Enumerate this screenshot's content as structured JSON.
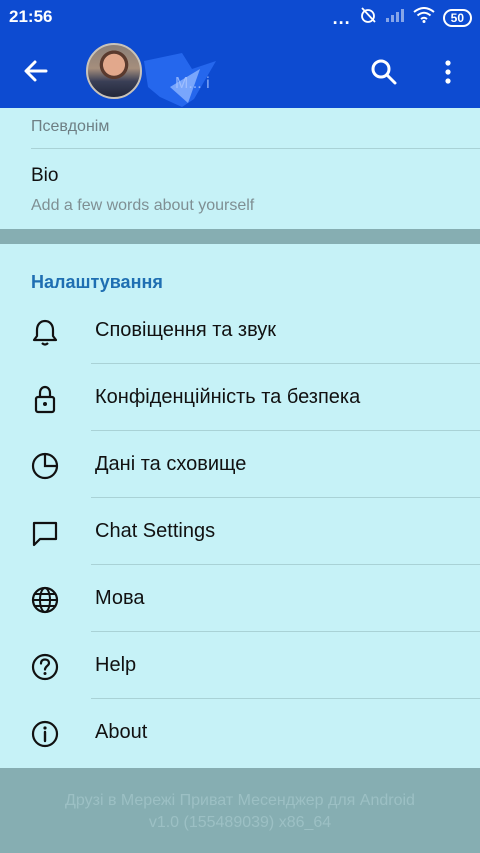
{
  "status_bar": {
    "time": "21:56",
    "dots": "...",
    "battery": "50"
  },
  "header": {
    "name": "M...  i"
  },
  "profile": {
    "nickname_label": "Псевдонім",
    "bio_title": "Bio",
    "bio_hint": "Add a few words about yourself"
  },
  "settings": {
    "header": "Налаштування",
    "items": [
      {
        "label": "Сповіщення та звук",
        "icon": "bell-icon"
      },
      {
        "label": "Конфіденційність та безпека",
        "icon": "lock-icon"
      },
      {
        "label": "Дані та сховище",
        "icon": "pie-chart-icon"
      },
      {
        "label": "Chat Settings",
        "icon": "chat-bubble-icon"
      },
      {
        "label": "Мова",
        "icon": "globe-icon"
      },
      {
        "label": "Help",
        "icon": "question-icon"
      },
      {
        "label": "About",
        "icon": "info-icon"
      }
    ]
  },
  "footer": {
    "line1": "Друзі в Мережі Приват Месенджер для Android",
    "line2": "v1.0 (155489039) x86_64"
  },
  "colors": {
    "header_bg": "#0d4bd1",
    "page_bg": "#c6f2f7",
    "accent": "#1f6fb2",
    "section_gap": "#86aeb2"
  }
}
